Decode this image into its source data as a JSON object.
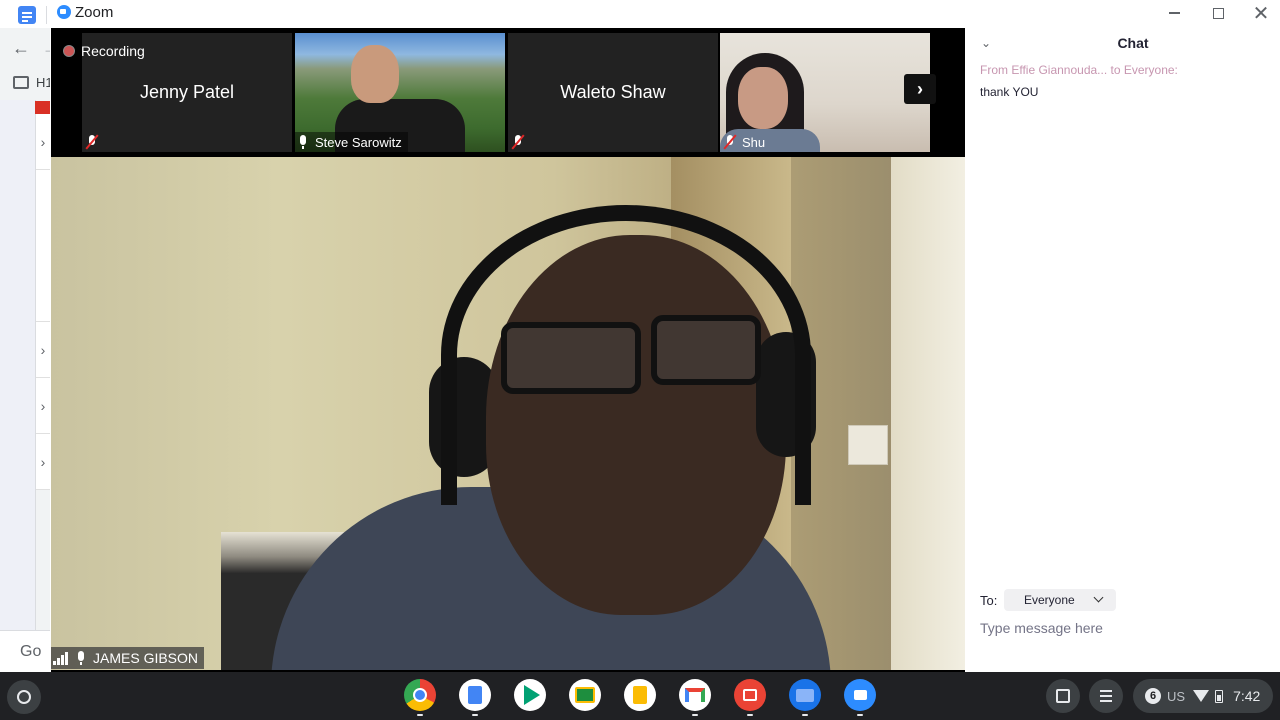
{
  "window": {
    "title": "Zoom"
  },
  "background_app": {
    "doc_heading_fragment": "H1",
    "go_text": "Go"
  },
  "meeting": {
    "recording_label": "Recording",
    "participants": [
      {
        "name": "Jenny Patel",
        "muted": true,
        "video": false
      },
      {
        "name": "Steve Sarowitz",
        "muted": false,
        "video": true
      },
      {
        "name": "Waleto Shaw",
        "muted": true,
        "video": false
      },
      {
        "name": "Shu",
        "muted": true,
        "video": true
      }
    ],
    "active_speaker": "JAMES GIBSON"
  },
  "chat": {
    "title": "Chat",
    "messages": [
      {
        "from": "From Effie Giannouda... to Everyone:",
        "text": "thank YOU"
      }
    ],
    "to_label": "To:",
    "recipient": "Everyone",
    "input_placeholder": "Type message here"
  },
  "shelf": {
    "apps": [
      "chrome-icon",
      "docs-icon",
      "play-store-icon",
      "classroom-icon",
      "slides-icon",
      "gmail-icon",
      "gallery-icon",
      "files-icon",
      "zoom-icon"
    ],
    "notification_count": "6",
    "ime": "US",
    "clock": "7:42"
  },
  "colors": {
    "zoom_blue": "#2d8cff",
    "chat_from": "#c796b0",
    "muted_red": "#e02828",
    "shelf_bg": "#202124"
  }
}
